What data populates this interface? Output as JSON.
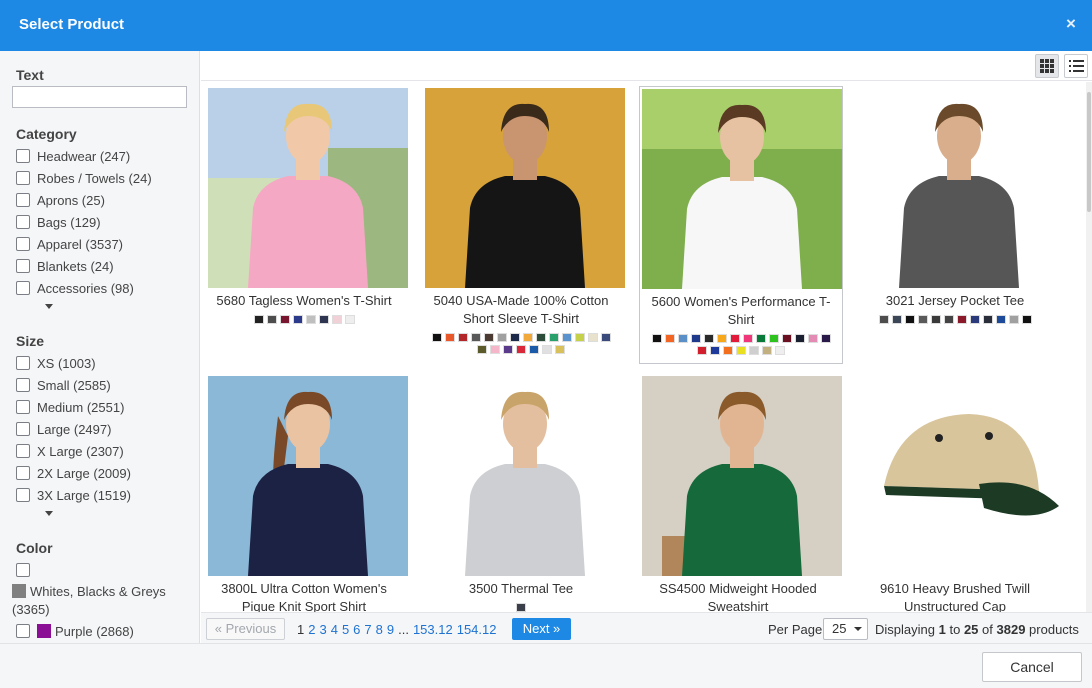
{
  "dialog": {
    "title": "Select Product",
    "close_icon": "×",
    "cancel_label": "Cancel"
  },
  "filters": {
    "text_label": "Text",
    "text_value": "",
    "category_label": "Category",
    "categories": [
      {
        "label": "Headwear (247)",
        "checked": false
      },
      {
        "label": "Robes / Towels (24)",
        "checked": false
      },
      {
        "label": "Aprons (25)",
        "checked": false
      },
      {
        "label": "Bags (129)",
        "checked": false
      },
      {
        "label": "Apparel (3537)",
        "checked": false
      },
      {
        "label": "Blankets (24)",
        "checked": false
      },
      {
        "label": "Accessories (98)",
        "checked": false
      }
    ],
    "size_label": "Size",
    "sizes": [
      {
        "label": "XS (1003)",
        "checked": false
      },
      {
        "label": "Small (2585)",
        "checked": false
      },
      {
        "label": "Medium (2551)",
        "checked": false
      },
      {
        "label": "Large (2497)",
        "checked": false
      },
      {
        "label": "X Large (2307)",
        "checked": false
      },
      {
        "label": "2X Large (2009)",
        "checked": false
      },
      {
        "label": "3X Large (1519)",
        "checked": false
      }
    ],
    "color_label": "Color",
    "colors": [
      {
        "label": "Whites, Blacks & Greys",
        "count": "(3365)",
        "swatch": "#808080"
      },
      {
        "label": "Purple (2868)",
        "swatch": "#8b0f94"
      }
    ]
  },
  "toolbar": {
    "grid_view_icon": "grid-view-icon",
    "list_view_icon": "list-view-icon",
    "active_view": "grid"
  },
  "products": [
    {
      "name": "5680 Tagless Women's T-Shirt",
      "photo": "pink-tshirt",
      "colors": [
        "#222222",
        "#4d4d4d",
        "#7a1530",
        "#2b3a8a",
        "#bfbfbf",
        "#2e3550",
        "#f2d0d8",
        "#eeeeee"
      ]
    },
    {
      "name": "5040 USA-Made 100% Cotton Short Sleeve T-Shirt",
      "photo": "black-tshirt",
      "colors": [
        "#111111",
        "#e8582a",
        "#b3262a",
        "#585858",
        "#4a3a32",
        "#a0a0a0",
        "#1e2a4a",
        "#f2a93b",
        "#2e4c3a",
        "#2aa06b",
        "#5b93cf",
        "#c6d14a",
        "#e8e2cc",
        "#3a4a7a",
        "#5b5a2a",
        "#f4b6c8",
        "#5a3a8a",
        "#d8283a",
        "#1a5aa8",
        "#e0e0e0",
        "#d8c05a"
      ]
    },
    {
      "name": "5600 Women's Performance T-Shirt",
      "photo": "white-tshirt",
      "colors": [
        "#111111",
        "#f26522",
        "#5b8fc7",
        "#1f3a8a",
        "#2a2a2a",
        "#f7a81b",
        "#e31b3a",
        "#f0377a",
        "#0a7a3a",
        "#2ec21f",
        "#6a1020",
        "#1a2030",
        "#e48bb3",
        "#2a1a4a",
        "#d21f2e",
        "#1e3a9a",
        "#f36e1d",
        "#e8e020",
        "#cfcfcf",
        "#c2b080",
        "#eeeeee"
      ]
    },
    {
      "name": "3021 Jersey Pocket Tee",
      "photo": "pocket-tee",
      "colors": [
        "#4d4d4d",
        "#3b4657",
        "#111111",
        "#5a5a5a",
        "#3a3a3a",
        "#444444",
        "#8a1a2a",
        "#2a3a7a",
        "#2a2e3a",
        "#1e4a9a",
        "#a0a0a0",
        "#111111"
      ]
    },
    {
      "name": "3800L Ultra Cotton Women's Pique Knit Sport Shirt",
      "photo": "navy-polo",
      "colors": []
    },
    {
      "name": "3500 Thermal Tee",
      "photo": "thermal-tee",
      "colors": [
        "#3a3f4a"
      ]
    },
    {
      "name": "SS4500 Midweight Hooded Sweatshirt",
      "photo": "green-hoodie",
      "colors": []
    },
    {
      "name": "9610 Heavy Brushed Twill Unstructured Cap",
      "photo": "khaki-cap",
      "colors": []
    }
  ],
  "pagination": {
    "prev_label": "« Previous",
    "current_page": "1",
    "pages": [
      "2",
      "3",
      "4",
      "5",
      "6",
      "7",
      "8",
      "9"
    ],
    "ellipsis": "...",
    "tail_pages": [
      "153.12",
      "154.12"
    ],
    "next_label": "Next »",
    "per_page_label": "Per Page",
    "per_page_value": "25",
    "displaying_prefix": "Displaying",
    "from": "1",
    "to_word": "to",
    "to": "25",
    "of_word": "of",
    "total": "3829",
    "suffix": "products"
  }
}
